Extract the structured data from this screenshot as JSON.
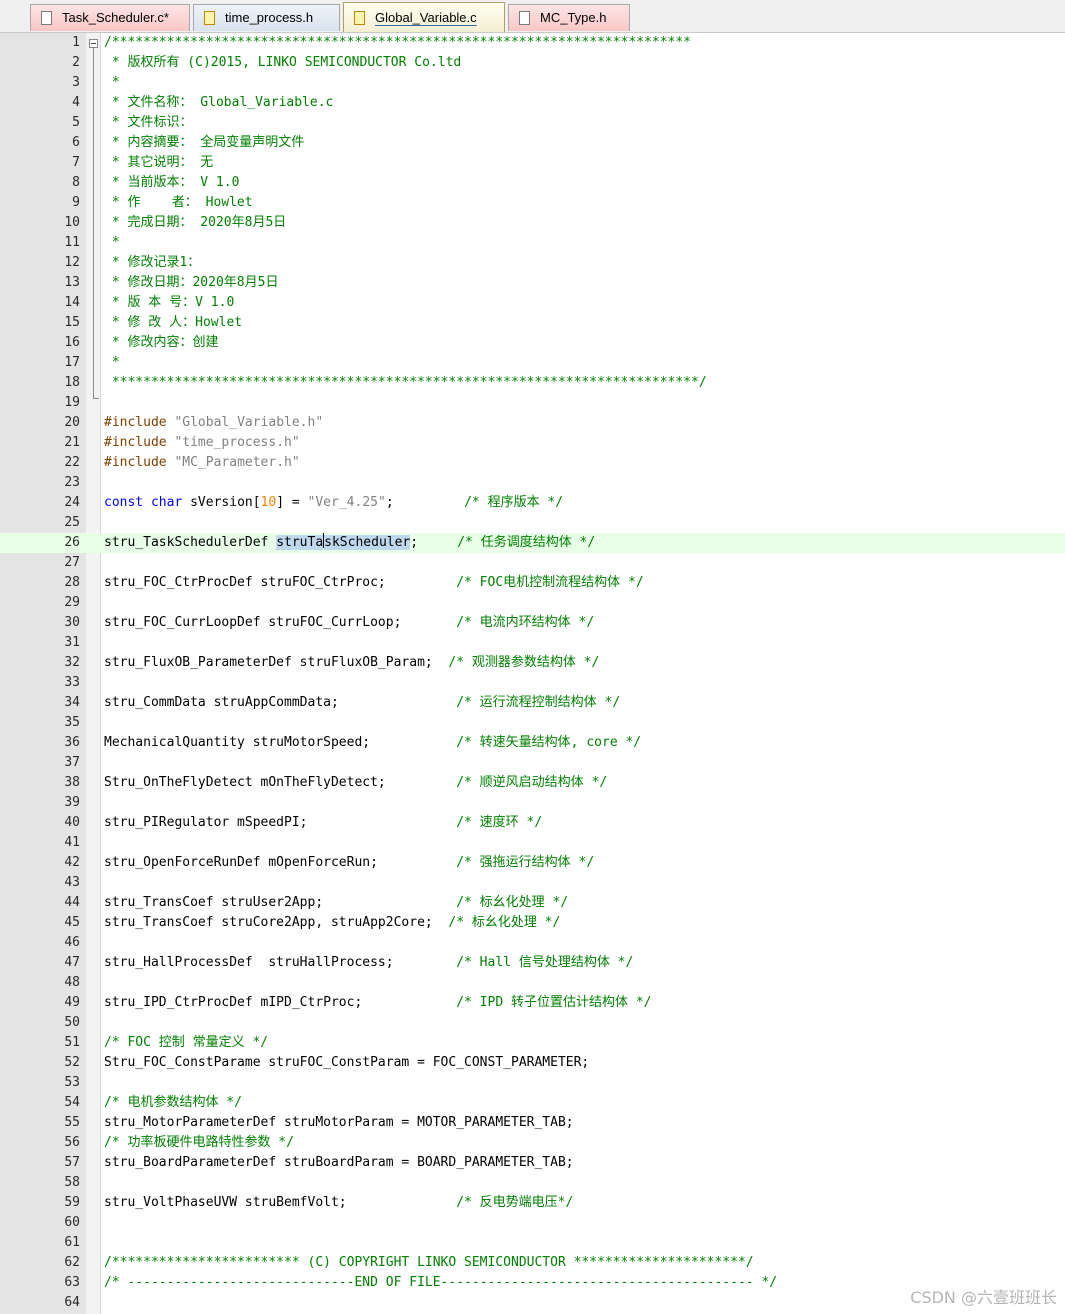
{
  "tabs": [
    {
      "label": "Task_Scheduler.c*",
      "state": "unsaved"
    },
    {
      "label": "time_process.h",
      "state": "saved"
    },
    {
      "label": "Global_Variable.c",
      "state": "active"
    },
    {
      "label": "MC_Type.h",
      "state": "unsaved"
    }
  ],
  "code_lines": [
    {
      "n": "1",
      "segs": [
        {
          "t": "/**************************************************************************",
          "c": "c"
        }
      ]
    },
    {
      "n": "2",
      "segs": [
        {
          "t": " * 版权所有 (C)2015, LINKO SEMICONDUCTOR Co.ltd",
          "c": "c"
        }
      ]
    },
    {
      "n": "3",
      "segs": [
        {
          "t": " *",
          "c": "c"
        }
      ]
    },
    {
      "n": "4",
      "segs": [
        {
          "t": " * 文件名称： Global_Variable.c",
          "c": "c"
        }
      ]
    },
    {
      "n": "5",
      "segs": [
        {
          "t": " * 文件标识：",
          "c": "c"
        }
      ]
    },
    {
      "n": "6",
      "segs": [
        {
          "t": " * 内容摘要： 全局变量声明文件",
          "c": "c"
        }
      ]
    },
    {
      "n": "7",
      "segs": [
        {
          "t": " * 其它说明： 无",
          "c": "c"
        }
      ]
    },
    {
      "n": "8",
      "segs": [
        {
          "t": " * 当前版本： V 1.0",
          "c": "c"
        }
      ]
    },
    {
      "n": "9",
      "segs": [
        {
          "t": " * 作    者： Howlet",
          "c": "c"
        }
      ]
    },
    {
      "n": "10",
      "segs": [
        {
          "t": " * 完成日期： 2020年8月5日",
          "c": "c"
        }
      ]
    },
    {
      "n": "11",
      "segs": [
        {
          "t": " *",
          "c": "c"
        }
      ]
    },
    {
      "n": "12",
      "segs": [
        {
          "t": " * 修改记录1：",
          "c": "c"
        }
      ]
    },
    {
      "n": "13",
      "segs": [
        {
          "t": " * 修改日期：2020年8月5日",
          "c": "c"
        }
      ]
    },
    {
      "n": "14",
      "segs": [
        {
          "t": " * 版 本 号：V 1.0",
          "c": "c"
        }
      ]
    },
    {
      "n": "15",
      "segs": [
        {
          "t": " * 修 改 人：Howlet",
          "c": "c"
        }
      ]
    },
    {
      "n": "16",
      "segs": [
        {
          "t": " * 修改内容：创建",
          "c": "c"
        }
      ]
    },
    {
      "n": "17",
      "segs": [
        {
          "t": " *",
          "c": "c"
        }
      ]
    },
    {
      "n": "18",
      "segs": [
        {
          "t": " ***************************************************************************/",
          "c": "c"
        }
      ]
    },
    {
      "n": "19",
      "segs": []
    },
    {
      "n": "20",
      "segs": [
        {
          "t": "#include ",
          "c": "p"
        },
        {
          "t": "\"Global_Variable.h\"",
          "c": "s"
        }
      ]
    },
    {
      "n": "21",
      "segs": [
        {
          "t": "#include ",
          "c": "p"
        },
        {
          "t": "\"time_process.h\"",
          "c": "s"
        }
      ]
    },
    {
      "n": "22",
      "segs": [
        {
          "t": "#include ",
          "c": "p"
        },
        {
          "t": "\"MC_Parameter.h\"",
          "c": "s"
        }
      ]
    },
    {
      "n": "23",
      "segs": []
    },
    {
      "n": "24",
      "segs": [
        {
          "t": "const",
          "c": "k"
        },
        {
          "t": " "
        },
        {
          "t": "char",
          "c": "k"
        },
        {
          "t": " sVersion["
        },
        {
          "t": "10",
          "c": "n"
        },
        {
          "t": "] = "
        },
        {
          "t": "\"Ver_4.25\"",
          "c": "s"
        },
        {
          "t": ";         "
        },
        {
          "t": "/* 程序版本 */",
          "c": "c"
        }
      ]
    },
    {
      "n": "25",
      "segs": []
    },
    {
      "n": "26",
      "hl": true,
      "segs": [
        {
          "t": "stru_TaskSchedulerDef "
        },
        {
          "t": "struTa",
          "c": "sel"
        },
        {
          "t": "",
          "c": "caret"
        },
        {
          "t": "skScheduler",
          "c": "sel"
        },
        {
          "t": ";     "
        },
        {
          "t": "/* 任务调度结构体 */",
          "c": "c"
        }
      ]
    },
    {
      "n": "27",
      "segs": []
    },
    {
      "n": "28",
      "segs": [
        {
          "t": "stru_FOC_CtrProcDef struFOC_CtrProc;         "
        },
        {
          "t": "/* FOC电机控制流程结构体 */",
          "c": "c"
        }
      ]
    },
    {
      "n": "29",
      "segs": []
    },
    {
      "n": "30",
      "segs": [
        {
          "t": "stru_FOC_CurrLoopDef struFOC_CurrLoop;       "
        },
        {
          "t": "/* 电流内环结构体 */",
          "c": "c"
        }
      ]
    },
    {
      "n": "31",
      "segs": []
    },
    {
      "n": "32",
      "segs": [
        {
          "t": "stru_FluxOB_ParameterDef struFluxOB_Param;  "
        },
        {
          "t": "/* 观测器参数结构体 */",
          "c": "c"
        }
      ]
    },
    {
      "n": "33",
      "segs": []
    },
    {
      "n": "34",
      "segs": [
        {
          "t": "stru_CommData struAppCommData;               "
        },
        {
          "t": "/* 运行流程控制结构体 */",
          "c": "c"
        }
      ]
    },
    {
      "n": "35",
      "segs": []
    },
    {
      "n": "36",
      "segs": [
        {
          "t": "MechanicalQuantity struMotorSpeed;           "
        },
        {
          "t": "/* 转速矢量结构体, core */",
          "c": "c"
        }
      ]
    },
    {
      "n": "37",
      "segs": []
    },
    {
      "n": "38",
      "segs": [
        {
          "t": "Stru_OnTheFlyDetect mOnTheFlyDetect;         "
        },
        {
          "t": "/* 顺逆风启动结构体 */",
          "c": "c"
        }
      ]
    },
    {
      "n": "39",
      "segs": []
    },
    {
      "n": "40",
      "segs": [
        {
          "t": "stru_PIRegulator mSpeedPI;                   "
        },
        {
          "t": "/* 速度环 */",
          "c": "c"
        }
      ]
    },
    {
      "n": "41",
      "segs": []
    },
    {
      "n": "42",
      "segs": [
        {
          "t": "stru_OpenForceRunDef mOpenForceRun;          "
        },
        {
          "t": "/* 强拖运行结构体 */",
          "c": "c"
        }
      ]
    },
    {
      "n": "43",
      "segs": []
    },
    {
      "n": "44",
      "segs": [
        {
          "t": "stru_TransCoef struUser2App;                 "
        },
        {
          "t": "/* 标幺化处理 */",
          "c": "c"
        }
      ]
    },
    {
      "n": "45",
      "segs": [
        {
          "t": "stru_TransCoef struCore2App, struApp2Core;  "
        },
        {
          "t": "/* 标幺化处理 */",
          "c": "c"
        }
      ]
    },
    {
      "n": "46",
      "segs": []
    },
    {
      "n": "47",
      "segs": [
        {
          "t": "stru_HallProcessDef  struHallProcess;        "
        },
        {
          "t": "/* Hall 信号处理结构体 */",
          "c": "c"
        }
      ]
    },
    {
      "n": "48",
      "segs": []
    },
    {
      "n": "49",
      "segs": [
        {
          "t": "stru_IPD_CtrProcDef mIPD_CtrProc;            "
        },
        {
          "t": "/* IPD 转子位置估计结构体 */",
          "c": "c"
        }
      ]
    },
    {
      "n": "50",
      "segs": []
    },
    {
      "n": "51",
      "segs": [
        {
          "t": "/* FOC 控制 常量定义 */",
          "c": "c"
        }
      ]
    },
    {
      "n": "52",
      "segs": [
        {
          "t": "Stru_FOC_ConstParame struFOC_ConstParam = FOC_CONST_PARAMETER;"
        }
      ]
    },
    {
      "n": "53",
      "segs": []
    },
    {
      "n": "54",
      "segs": [
        {
          "t": "/* 电机参数结构体 */",
          "c": "c"
        }
      ]
    },
    {
      "n": "55",
      "segs": [
        {
          "t": "stru_MotorParameterDef struMotorParam = MOTOR_PARAMETER_TAB;"
        }
      ]
    },
    {
      "n": "56",
      "segs": [
        {
          "t": "/* 功率板硬件电路特性参数 */",
          "c": "c"
        }
      ]
    },
    {
      "n": "57",
      "segs": [
        {
          "t": "stru_BoardParameterDef struBoardParam = BOARD_PARAMETER_TAB;"
        }
      ]
    },
    {
      "n": "58",
      "segs": []
    },
    {
      "n": "59",
      "segs": [
        {
          "t": "stru_VoltPhaseUVW struBemfVolt;              "
        },
        {
          "t": "/* 反电势端电压*/",
          "c": "c"
        }
      ]
    },
    {
      "n": "60",
      "segs": []
    },
    {
      "n": "61",
      "segs": []
    },
    {
      "n": "62",
      "segs": [
        {
          "t": "/************************ (C) COPYRIGHT LINKO SEMICONDUCTOR **********************/",
          "c": "c"
        }
      ]
    },
    {
      "n": "63",
      "segs": [
        {
          "t": "/* -----------------------------END OF FILE---------------------------------------- */",
          "c": "c"
        }
      ]
    },
    {
      "n": "64",
      "segs": []
    }
  ],
  "watermark": "CSDN @六壹班班长",
  "colors": {
    "comment": "#008000",
    "preprocessor": "#804000",
    "string": "#808080",
    "keyword": "#0000ff",
    "number": "#ff8000",
    "current_line": "#e8ffe8",
    "selection": "#c0d8ee"
  }
}
